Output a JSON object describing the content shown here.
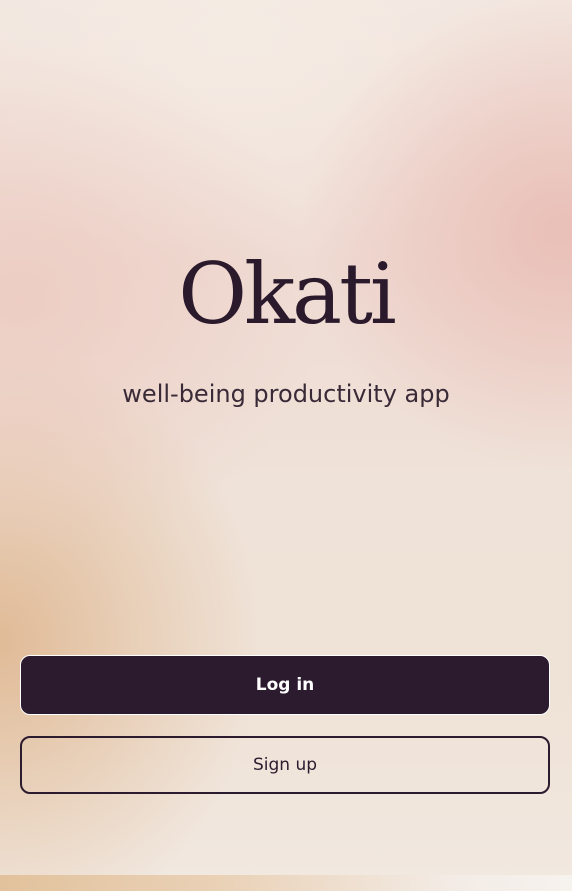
{
  "app": {
    "logo_text": "Okati",
    "tagline": "well-being productivity app"
  },
  "actions": {
    "login_label": "Log in",
    "signup_label": "Sign up"
  },
  "colors": {
    "primary": "#2c1a2e",
    "primary_text": "#ffffff"
  }
}
